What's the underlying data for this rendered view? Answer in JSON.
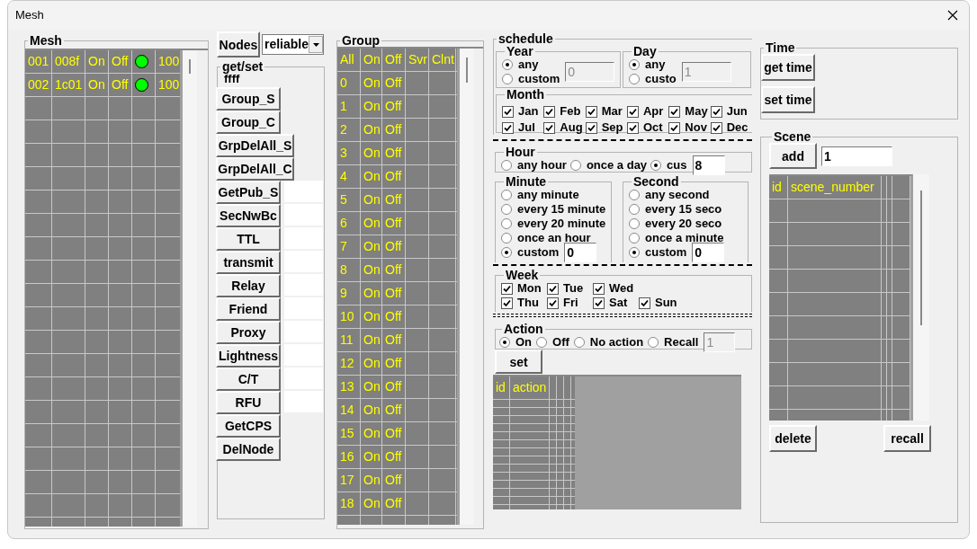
{
  "window": {
    "title": "Mesh"
  },
  "mesh": {
    "title": "Mesh",
    "rows": [
      {
        "column_1": "001",
        "column_2": "008f",
        "column_3": "On",
        "column_4": "Off",
        "color": "#00ff00",
        "column_6": "100"
      },
      {
        "column_1": "002",
        "column_2": "1c01",
        "column_3": "On",
        "column_4": "Off",
        "color": "#00ff00",
        "column_6": "100"
      }
    ]
  },
  "nodes_button": "Nodes",
  "mode_select": {
    "value": "reliable"
  },
  "get_set": {
    "title": "get/set",
    "address": "ffff",
    "buttons": [
      {
        "label": "Group_S",
        "kind": "plain"
      },
      {
        "label": "Group_C",
        "kind": "plain"
      },
      {
        "label": "GrpDelAll_S",
        "kind": "wide"
      },
      {
        "label": "GrpDelAll_C",
        "kind": "wide"
      },
      {
        "label": "GetPub_S",
        "kind": "with_field"
      },
      {
        "label": "SecNwBc",
        "kind": "with_field"
      },
      {
        "label": "TTL",
        "kind": "with_field"
      },
      {
        "label": "transmit",
        "kind": "with_field"
      },
      {
        "label": "Relay",
        "kind": "with_field"
      },
      {
        "label": "Friend",
        "kind": "with_field"
      },
      {
        "label": "Proxy",
        "kind": "with_field"
      },
      {
        "label": "Lightness",
        "kind": "with_field"
      },
      {
        "label": "C/T",
        "kind": "with_field"
      },
      {
        "label": "RFU",
        "kind": "with_field"
      },
      {
        "label": "GetCPS",
        "kind": "plain"
      },
      {
        "label": "DelNode",
        "kind": "plain"
      }
    ]
  },
  "group": {
    "title": "Group",
    "columns": [
      "All",
      "On",
      "Off",
      "Svr",
      "Clnt"
    ],
    "rows": [
      {
        "group": "0",
        "on": "On",
        "off": "Off"
      },
      {
        "group": "1",
        "on": "On",
        "off": "Off"
      },
      {
        "group": "2",
        "on": "On",
        "off": "Off"
      },
      {
        "group": "3",
        "on": "On",
        "off": "Off"
      },
      {
        "group": "4",
        "on": "On",
        "off": "Off"
      },
      {
        "group": "5",
        "on": "On",
        "off": "Off"
      },
      {
        "group": "6",
        "on": "On",
        "off": "Off"
      },
      {
        "group": "7",
        "on": "On",
        "off": "Off"
      },
      {
        "group": "8",
        "on": "On",
        "off": "Off"
      },
      {
        "group": "9",
        "on": "On",
        "off": "Off"
      },
      {
        "group": "10",
        "on": "On",
        "off": "Off"
      },
      {
        "group": "11",
        "on": "On",
        "off": "Off"
      },
      {
        "group": "12",
        "on": "On",
        "off": "Off"
      },
      {
        "group": "13",
        "on": "On",
        "off": "Off"
      },
      {
        "group": "14",
        "on": "On",
        "off": "Off"
      },
      {
        "group": "15",
        "on": "On",
        "off": "Off"
      },
      {
        "group": "16",
        "on": "On",
        "off": "Off"
      },
      {
        "group": "17",
        "on": "On",
        "off": "Off"
      },
      {
        "group": "18",
        "on": "On",
        "off": "Off"
      }
    ]
  },
  "schedule": {
    "title": "schedule",
    "year": {
      "title": "Year",
      "options": [
        {
          "label": "any",
          "selected": true
        },
        {
          "label": "custom",
          "selected": false
        }
      ],
      "value": "0",
      "disabled": true
    },
    "day": {
      "title": "Day",
      "options": [
        {
          "label": "any",
          "selected": true
        },
        {
          "label": "custo",
          "selected": false
        }
      ],
      "value": "1",
      "disabled": true
    },
    "month": {
      "title": "Month",
      "items": [
        {
          "label": "Jan",
          "checked": true
        },
        {
          "label": "Feb",
          "checked": true
        },
        {
          "label": "Mar",
          "checked": true
        },
        {
          "label": "Apr",
          "checked": true
        },
        {
          "label": "May",
          "checked": true
        },
        {
          "label": "Jun",
          "checked": true
        },
        {
          "label": "Jul",
          "checked": true
        },
        {
          "label": "Aug",
          "checked": true
        },
        {
          "label": "Sep",
          "checked": true
        },
        {
          "label": "Oct",
          "checked": true
        },
        {
          "label": "Nov",
          "checked": true
        },
        {
          "label": "Dec",
          "checked": true
        }
      ]
    },
    "hour": {
      "title": "Hour",
      "options": [
        {
          "label": "any hour",
          "selected": false
        },
        {
          "label": "once a day",
          "selected": false
        },
        {
          "label": "cus",
          "selected": true
        }
      ],
      "value": "8"
    },
    "minute": {
      "title": "Minute",
      "options": [
        {
          "label": "any minute",
          "selected": false
        },
        {
          "label": "every 15 minute",
          "selected": false
        },
        {
          "label": "every 20 minute",
          "selected": false
        },
        {
          "label": "once an hour",
          "selected": false
        },
        {
          "label": "custom",
          "selected": true
        }
      ],
      "value": "0"
    },
    "second": {
      "title": "Second",
      "options": [
        {
          "label": "any second",
          "selected": false
        },
        {
          "label": "every 15 seco",
          "selected": false
        },
        {
          "label": "every 20 seco",
          "selected": false
        },
        {
          "label": "once a minute",
          "selected": false
        },
        {
          "label": "custom",
          "selected": true
        }
      ],
      "value": "0"
    },
    "week": {
      "title": "Week",
      "items": [
        {
          "label": "Mon",
          "checked": true
        },
        {
          "label": "Tue",
          "checked": true
        },
        {
          "label": "Wed",
          "checked": true
        },
        {
          "label": "Thu",
          "checked": true
        },
        {
          "label": "Fri",
          "checked": true
        },
        {
          "label": "Sat",
          "checked": true
        },
        {
          "label": "Sun",
          "checked": true
        }
      ]
    },
    "action": {
      "title": "Action",
      "options": [
        {
          "label": "On",
          "selected": true
        },
        {
          "label": "Off",
          "selected": false
        },
        {
          "label": "No action",
          "selected": false
        },
        {
          "label": "Recall",
          "selected": false
        }
      ],
      "value": "1",
      "disabled": true
    },
    "set_button": "set",
    "table": {
      "columns": [
        "id",
        "action"
      ]
    }
  },
  "time": {
    "title": "Time",
    "buttons": [
      "get time",
      "set time"
    ]
  },
  "scene": {
    "title": "Scene",
    "add_button": "add",
    "number_field": {
      "value": "1"
    },
    "table": {
      "columns": [
        "id",
        "scene_number"
      ]
    },
    "buttons": [
      "delete",
      "recall"
    ]
  }
}
